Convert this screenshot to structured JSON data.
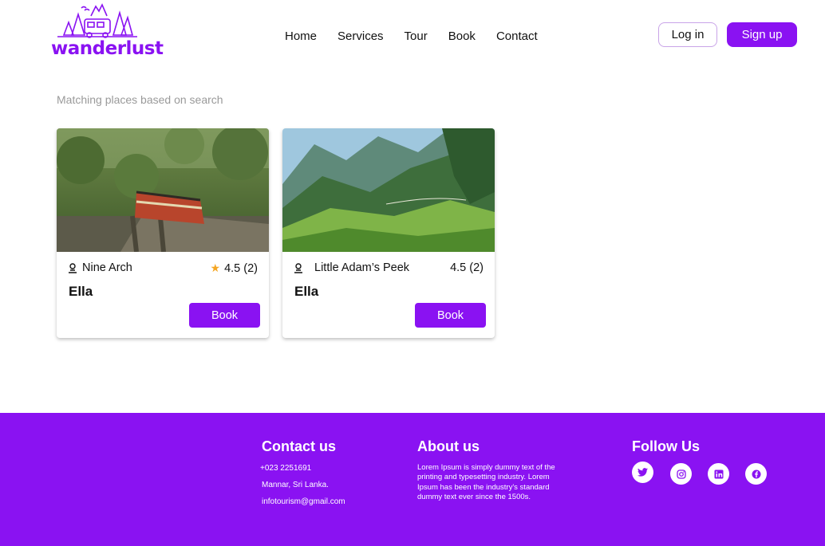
{
  "header": {
    "logo_text": "wanderlust",
    "nav": [
      "Home",
      "Services",
      "Tour",
      "Book",
      "Contact"
    ],
    "login_label": "Log in",
    "signup_label": "Sign up"
  },
  "main": {
    "subtitle": "Matching places based on search",
    "cards": [
      {
        "place": "Nine Arch",
        "rating": "4.5 (2)",
        "city": "Ella",
        "book_label": "Book"
      },
      {
        "place": "Little Adam’s Peek",
        "rating": "4.5 (2)",
        "city": "Ella",
        "book_label": "Book"
      }
    ]
  },
  "footer": {
    "contact": {
      "title": "Contact us",
      "phone": "+023 2251691",
      "address": "Mannar, Sri Lanka.",
      "email": "infotourism@gmail.com"
    },
    "about": {
      "title": "About us",
      "text": "Lorem Ipsum is simply dummy text of the printing and typesetting industry. Lorem Ipsum has been the industry's standard dummy text ever since the 1500s."
    },
    "follow": {
      "title": "Follow Us",
      "icons": [
        "twitter-icon",
        "instagram-icon",
        "linkedin-icon",
        "facebook-icon"
      ]
    }
  },
  "colors": {
    "brand": "#8a12f2",
    "star": "#f5a623"
  }
}
